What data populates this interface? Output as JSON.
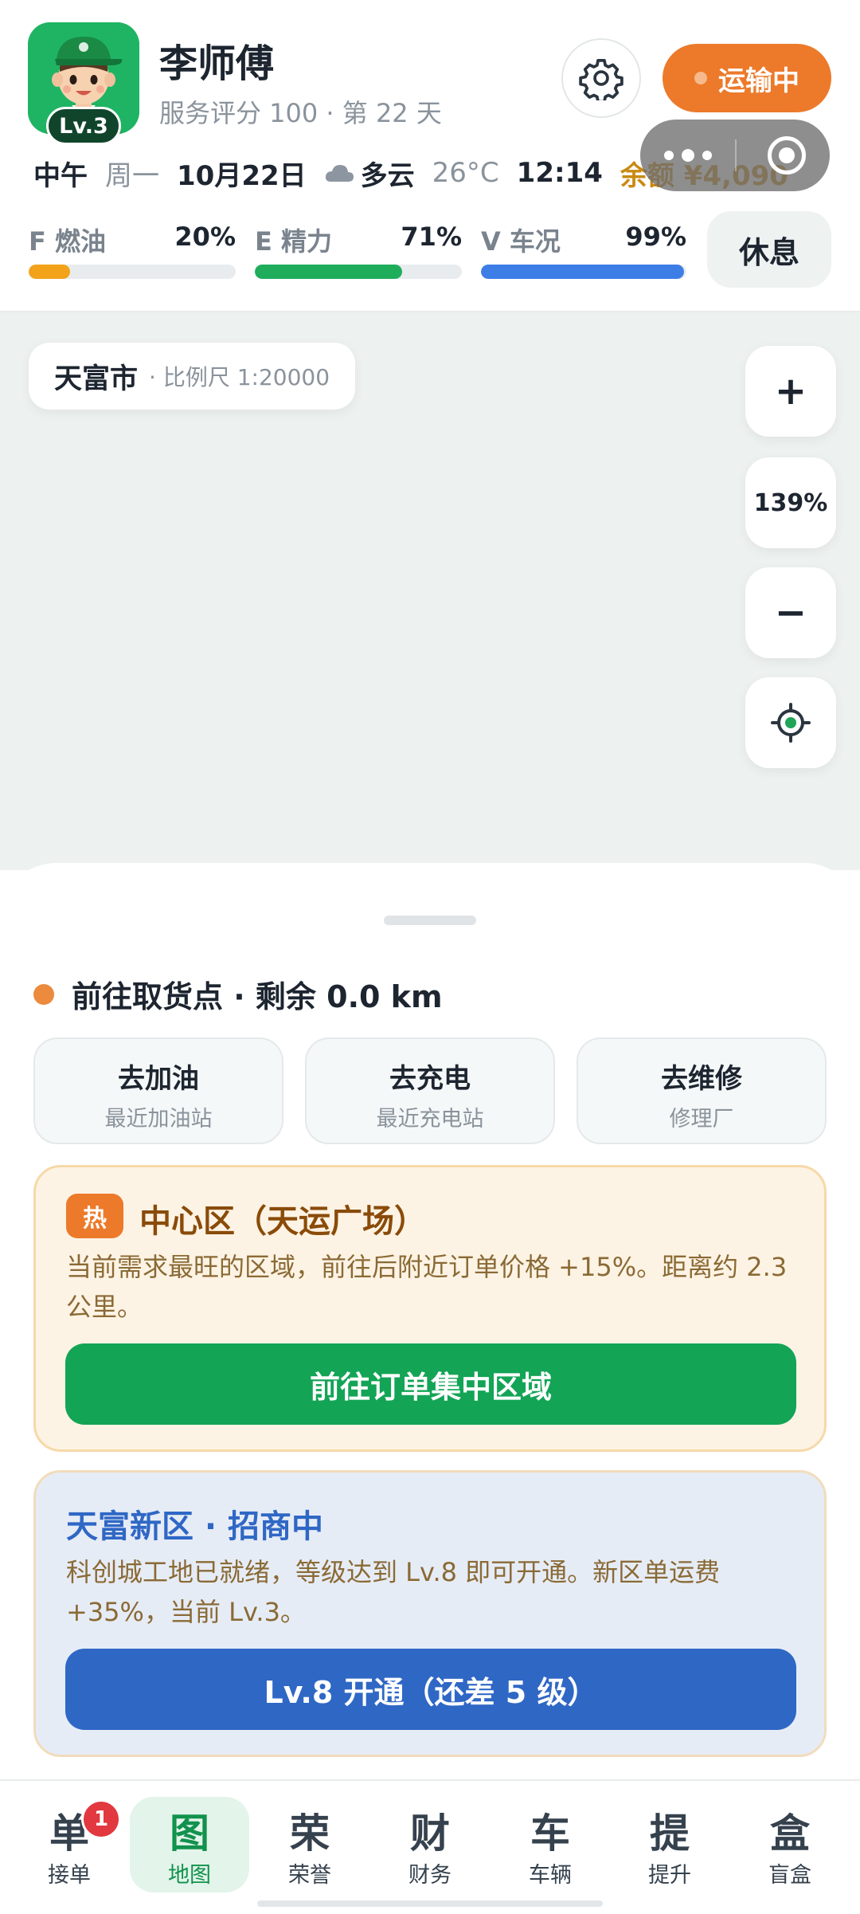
{
  "driver": {
    "name": "李师傅",
    "level": "Lv.3",
    "subtitle": "服务评分 100 · 第 22 天"
  },
  "status": {
    "label": "运输中"
  },
  "info": {
    "time_of_day": "中午",
    "weekday": "周一",
    "date": "10月22日",
    "weather": "多云",
    "temperature": "26°C",
    "clock": "12:14",
    "balance": "余额 ¥4,090"
  },
  "stats": [
    {
      "label": "F 燃油",
      "value": "20%",
      "level": 0.2,
      "color": "#f2a31a"
    },
    {
      "label": "E 精力",
      "value": "71%",
      "level": 0.71,
      "color": "#1fad5c"
    },
    {
      "label": "V 车况",
      "value": "99%",
      "level": 0.99,
      "color": "#3d7ee6"
    }
  ],
  "rest_button": "休息",
  "map": {
    "city": "天富市",
    "scale": "· 比例尺 1:20000",
    "zoom_in": "+",
    "zoom": "139%",
    "zoom_out": "−"
  },
  "route": {
    "text": "前往取货点 · 剩余 0.0 km"
  },
  "services": [
    {
      "title": "去加油",
      "sub": "最近加油站"
    },
    {
      "title": "去充电",
      "sub": "最近充电站"
    },
    {
      "title": "去维修",
      "sub": "修理厂"
    }
  ],
  "hot_zone": {
    "tag": "热",
    "title": "中心区（天运广场）",
    "desc": "当前需求最旺的区域，前往后附近订单价格 +15%。距离约 2.3 公里。",
    "button": "前往订单集中区域",
    "button_color": "#13a456"
  },
  "new_zone": {
    "title": "天富新区 · 招商中",
    "desc": "科创城工地已就绪，等级达到 Lv.8 即可开通。新区单运费 +35%，当前 Lv.3。",
    "button": "Lv.8 开通（还差 5 级）",
    "button_color": "#2f67c5"
  },
  "nav": [
    {
      "glyph": "单",
      "label": "接单",
      "badge": "1",
      "active": false
    },
    {
      "glyph": "图",
      "label": "地图",
      "active": true
    },
    {
      "glyph": "荣",
      "label": "荣誉",
      "active": false
    },
    {
      "glyph": "财",
      "label": "财务",
      "active": false
    },
    {
      "glyph": "车",
      "label": "车辆",
      "active": false
    },
    {
      "glyph": "提",
      "label": "提升",
      "active": false
    },
    {
      "glyph": "盒",
      "label": "盲盒",
      "active": false
    }
  ],
  "icons": [
    "avatar-driver",
    "gear-icon",
    "cloud-icon",
    "menu-dots-icon",
    "target-icon",
    "locate-icon"
  ]
}
